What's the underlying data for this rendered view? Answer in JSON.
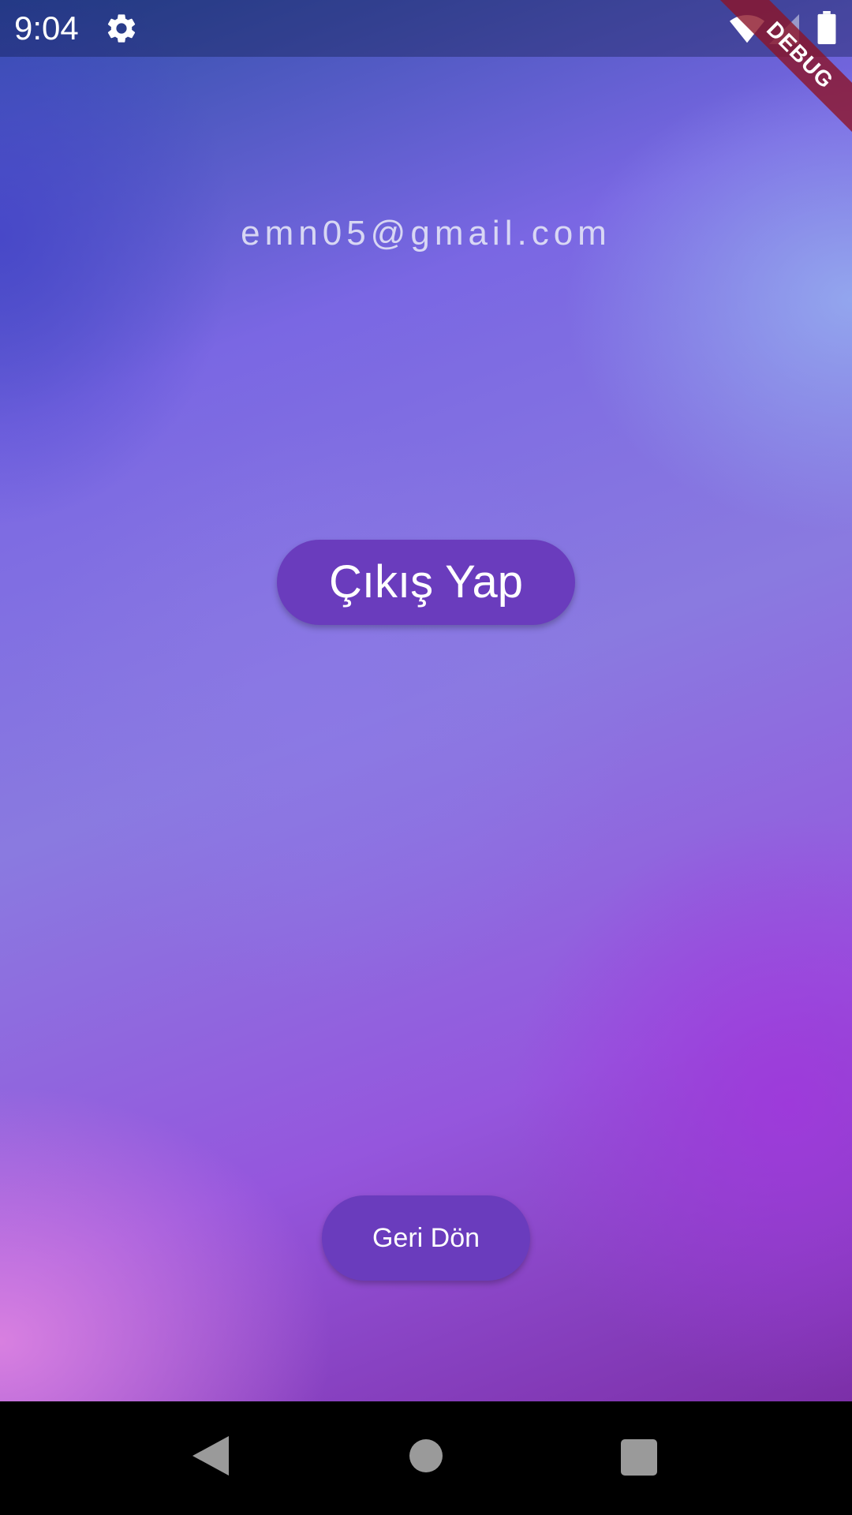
{
  "status_bar": {
    "time": "9:04",
    "icons": [
      "settings-gear-icon",
      "wifi-icon",
      "cellular-signal-icon",
      "battery-icon"
    ]
  },
  "debug_banner": {
    "label": "DEBUG"
  },
  "profile": {
    "email": "emn05@gmail.com"
  },
  "actions": {
    "logout_label": "Çıkış Yap",
    "back_label": "Geri Dön"
  },
  "navigation_bar": {
    "icons": [
      "back-triangle-icon",
      "home-circle-icon",
      "recents-square-icon"
    ]
  },
  "colors": {
    "button_bg": "#6a3cbd",
    "button_text": "#ffffff",
    "email_text": "#e1e1f5",
    "gradient_top_left": "#2f4fa8",
    "gradient_mid": "#8a7ae0",
    "gradient_bottom_right": "#7c2fa8",
    "gradient_bottom_left": "#dc82e1",
    "debug_banner": "#8c1428"
  }
}
